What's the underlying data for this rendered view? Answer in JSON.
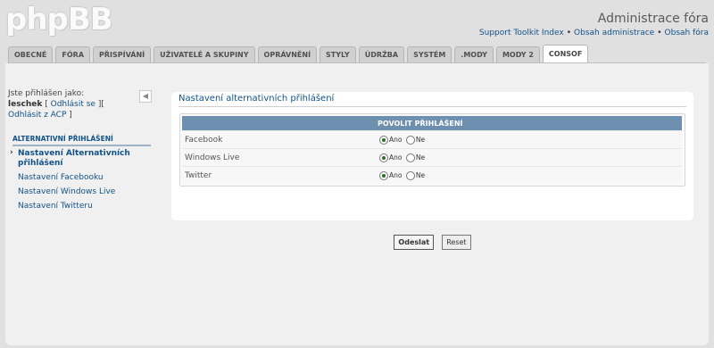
{
  "header": {
    "logo": "phpBB",
    "admin_title": "Administrace fóra",
    "links": [
      "Support Toolkit Index",
      "Obsah administrace",
      "Obsah fóra"
    ],
    "separator": "•"
  },
  "tabs": [
    {
      "label": "OBECNÉ"
    },
    {
      "label": "FÓRA"
    },
    {
      "label": "PŘISPÍVÁNÍ"
    },
    {
      "label": "UŽIVATELÉ A SKUPINY"
    },
    {
      "label": "OPRÁVNĚNÍ"
    },
    {
      "label": "STYLY"
    },
    {
      "label": "ÚDRŽBA"
    },
    {
      "label": "SYSTÉM"
    },
    {
      "label": ".MODY"
    },
    {
      "label": "MODY 2"
    },
    {
      "label": "CONSOF",
      "active": true
    }
  ],
  "sidebar": {
    "logged_in_as": "Jste přihlášen jako:",
    "username": "leschek",
    "logout_link": "Odhlásit se",
    "logout_acp_link": "Odhlásit z ACP",
    "collapse_icon": "triangle-left-icon",
    "section_title": "ALTERNATIVNÍ PŘIHLÁŠENÍ",
    "items": [
      {
        "label": "Nastavení Alternativních přihlášení",
        "active": true
      },
      {
        "label": "Nastavení Facebooku"
      },
      {
        "label": "Nastavení Windows Live"
      },
      {
        "label": "Nastavení Twitteru"
      }
    ]
  },
  "main": {
    "title": "Nastavení alternativních přihlášení",
    "table_header": "POVOLIT PŘIHLÁŠENÍ",
    "rows": [
      {
        "label": "Facebook",
        "yes": "Ano",
        "no": "Ne",
        "selected": "yes"
      },
      {
        "label": "Windows Live",
        "yes": "Ano",
        "no": "Ne",
        "selected": "yes"
      },
      {
        "label": "Twitter",
        "yes": "Ano",
        "no": "Ne",
        "selected": "yes"
      }
    ],
    "submit_label": "Odeslat",
    "reset_label": "Reset"
  },
  "colors": {
    "link": "#105289",
    "table_header_bg": "#6d8fb0",
    "background": "#e0e0e0"
  }
}
